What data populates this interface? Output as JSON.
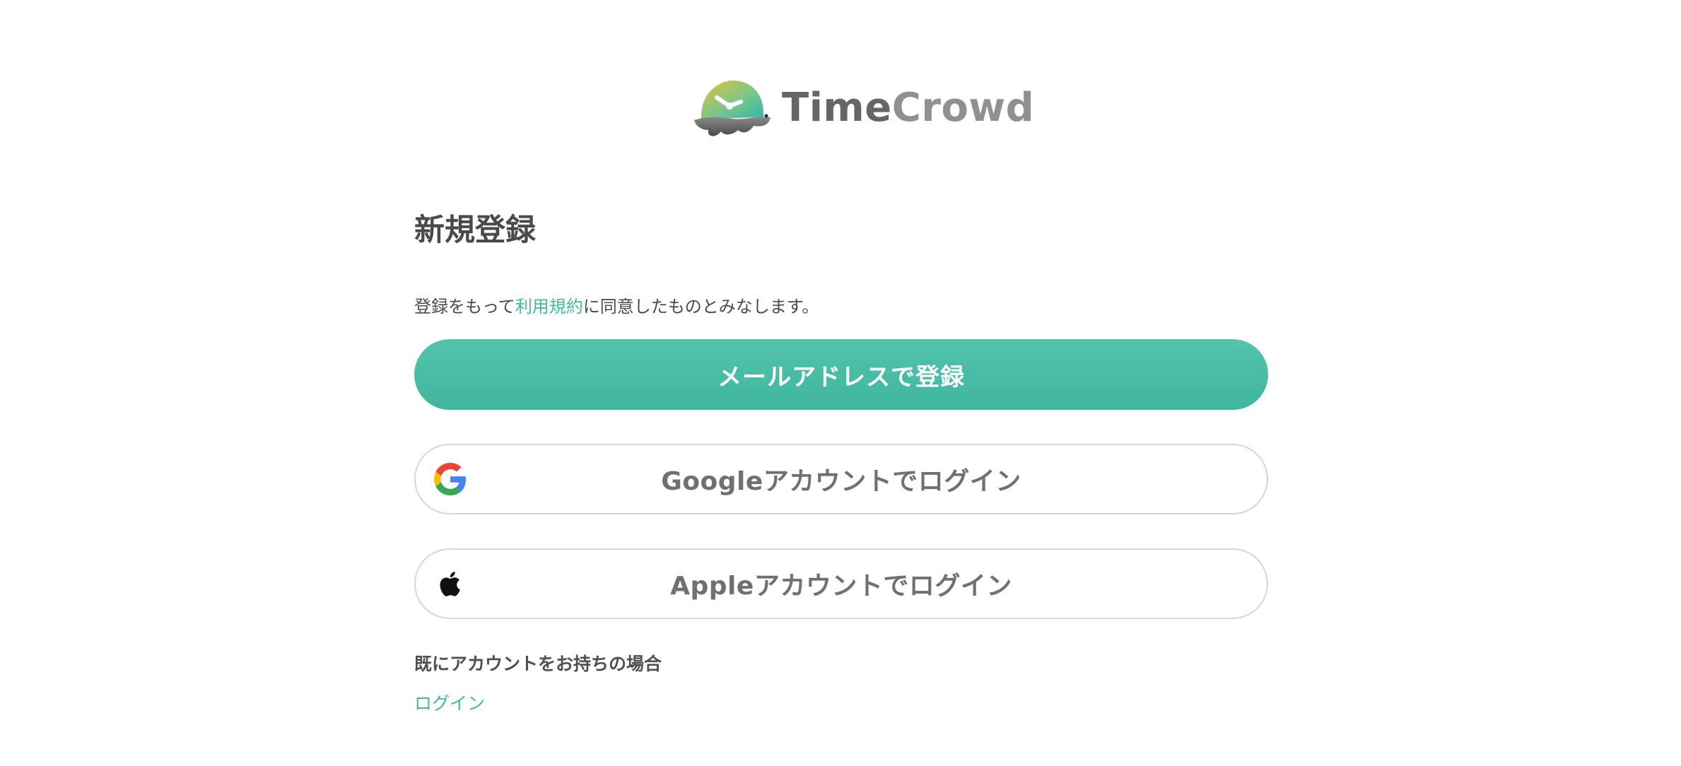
{
  "brand": {
    "name_part1": "Time",
    "name_part2": "Crowd"
  },
  "signup": {
    "title": "新規登録",
    "terms_prefix": "登録をもって",
    "terms_link": "利用規約",
    "terms_suffix": "に同意したものとみなします。",
    "email_button": "メールアドレスで登録",
    "google_button": "Googleアカウントでログイン",
    "apple_button": "Appleアカウントでログイン",
    "existing_account_text": "既にアカウントをお持ちの場合",
    "login_link": "ログイン"
  },
  "colors": {
    "accent": "#46b8a0",
    "button_primary": "#4bbda5",
    "text": "#4a4a4a",
    "border": "#d6d6d6"
  },
  "icons": {
    "logo": "timecrowd-clock-logo",
    "google": "google-g-icon",
    "apple": "apple-logo-icon"
  }
}
